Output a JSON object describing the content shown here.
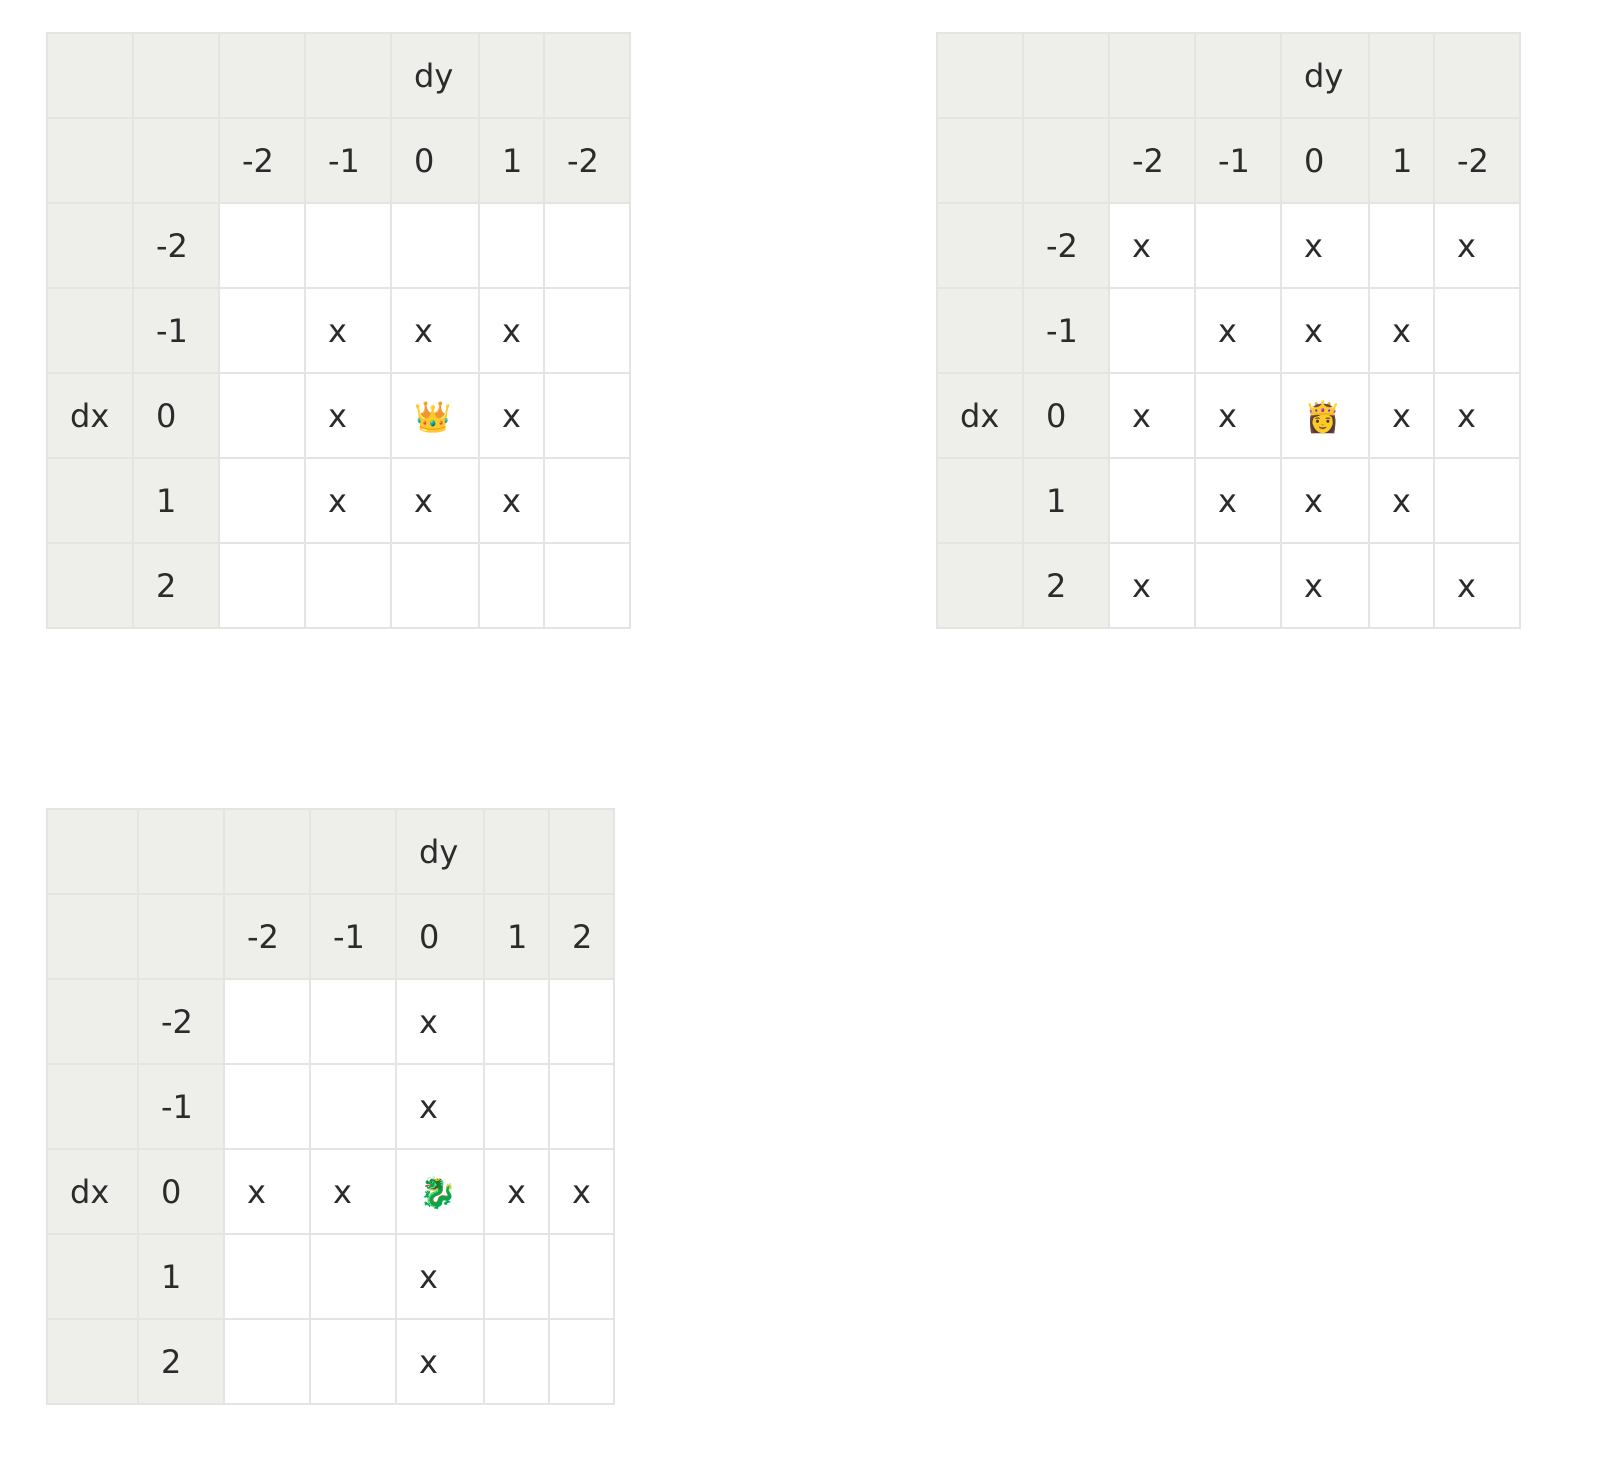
{
  "tables": [
    {
      "col_header_label": "dy",
      "row_header_label": "dx",
      "col_values": [
        "-2",
        "-1",
        "0",
        "1",
        "-2"
      ],
      "row_values": [
        "-2",
        "-1",
        "0",
        "1",
        "2"
      ],
      "cells": [
        [
          "",
          "",
          "",
          "",
          ""
        ],
        [
          "",
          "x",
          "x",
          "x",
          ""
        ],
        [
          "",
          "x",
          "👑",
          "x",
          ""
        ],
        [
          "",
          "x",
          "x",
          "x",
          ""
        ],
        [
          "",
          "",
          "",
          "",
          ""
        ]
      ]
    },
    {
      "col_header_label": "dy",
      "row_header_label": "dx",
      "col_values": [
        "-2",
        "-1",
        "0",
        "1",
        "-2"
      ],
      "row_values": [
        "-2",
        "-1",
        "0",
        "1",
        "2"
      ],
      "cells": [
        [
          "x",
          "",
          "x",
          "",
          "x"
        ],
        [
          "",
          "x",
          "x",
          "x",
          ""
        ],
        [
          "x",
          "x",
          "👸",
          "x",
          "x"
        ],
        [
          "",
          "x",
          "x",
          "x",
          ""
        ],
        [
          "x",
          "",
          "x",
          "",
          "x"
        ]
      ]
    },
    {
      "col_header_label": "dy",
      "row_header_label": "dx",
      "col_values": [
        "-2",
        "-1",
        "0",
        "1",
        "2"
      ],
      "row_values": [
        "-2",
        "-1",
        "0",
        "1",
        "2"
      ],
      "cells": [
        [
          "",
          "",
          "x",
          "",
          ""
        ],
        [
          "",
          "",
          "x",
          "",
          ""
        ],
        [
          "x",
          "x",
          "🐉",
          "x",
          "x"
        ],
        [
          "",
          "",
          "x",
          "",
          ""
        ],
        [
          "",
          "",
          "x",
          "",
          ""
        ]
      ]
    }
  ]
}
